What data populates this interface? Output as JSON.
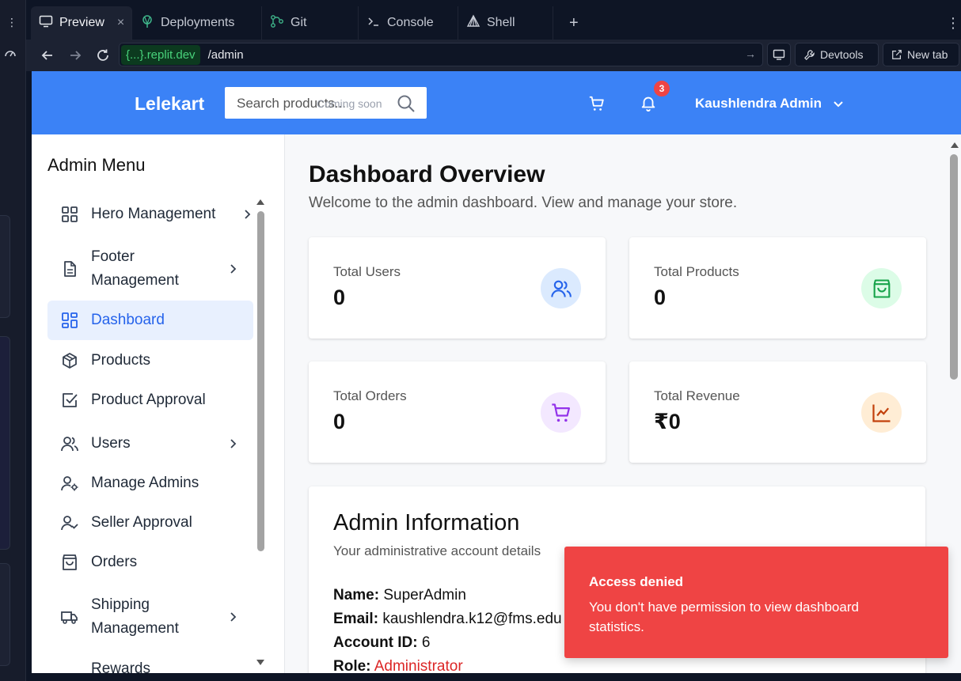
{
  "ide": {
    "tabs": [
      {
        "label": "Preview",
        "icon": "monitor-icon"
      },
      {
        "label": "Deployments",
        "icon": "deploy-icon"
      },
      {
        "label": "Git",
        "icon": "git-icon"
      },
      {
        "label": "Console",
        "icon": "terminal-icon"
      },
      {
        "label": "Shell",
        "icon": "shell-icon"
      }
    ],
    "new_tab_symbol": "+",
    "close_symbol": "×",
    "url_host": "{...}.replit.dev",
    "url_path": "/admin",
    "devtools_label": "Devtools",
    "new_tab_label": "New tab"
  },
  "header": {
    "logo": "Lelekart",
    "search_placeholder": "Search products...",
    "search_badge": "Coming soon",
    "notification_count": "3",
    "user_name": "Kaushlendra Admin"
  },
  "sidebar": {
    "title": "Admin Menu",
    "items": [
      {
        "label": "Hero Management",
        "icon": "grid-icon",
        "has_chevron": true
      },
      {
        "label": "Footer Management",
        "icon": "document-icon",
        "has_chevron": true
      },
      {
        "label": "Dashboard",
        "icon": "dashboard-icon",
        "active": true
      },
      {
        "label": "Products",
        "icon": "box-icon"
      },
      {
        "label": "Product Approval",
        "icon": "check-square-icon"
      },
      {
        "label": "Users",
        "icon": "users-icon",
        "has_chevron": true
      },
      {
        "label": "Manage Admins",
        "icon": "user-cog-icon"
      },
      {
        "label": "Seller Approval",
        "icon": "user-check-icon"
      },
      {
        "label": "Orders",
        "icon": "bag-icon"
      },
      {
        "label": "Shipping Management",
        "icon": "truck-icon",
        "has_chevron": true
      },
      {
        "label": "Rewards",
        "icon": "gift-icon"
      }
    ]
  },
  "main": {
    "title": "Dashboard Overview",
    "subtitle": "Welcome to the admin dashboard. View and manage your store.",
    "stats": [
      {
        "label": "Total Users",
        "value": "0",
        "icon": "users-icon",
        "color": "#2563eb",
        "bg": "#dbeafe"
      },
      {
        "label": "Total Products",
        "value": "0",
        "icon": "shopping-bag-icon",
        "color": "#16a34a",
        "bg": "#dcfce7"
      },
      {
        "label": "Total Orders",
        "value": "0",
        "icon": "cart-icon",
        "color": "#9333ea",
        "bg": "#f3e8ff"
      },
      {
        "label": "Total Revenue",
        "value": "₹0",
        "icon": "chart-line-icon",
        "color": "#c2410c",
        "bg": "#ffedd5"
      }
    ],
    "admin_info": {
      "title": "Admin Information",
      "subtitle": "Your administrative account details",
      "name_label": "Name:",
      "name_value": "SuperAdmin",
      "email_label": "Email:",
      "email_value": "kaushlendra.k12@fms.edu",
      "id_label": "Account ID:",
      "id_value": "6",
      "role_label": "Role:",
      "role_value": "Administrator"
    }
  },
  "toast": {
    "title": "Access denied",
    "message": "You don't have permission to view dashboard statistics.",
    "color": "#ef4444"
  },
  "colors": {
    "brand": "#3b82f6",
    "ide_bg": "#0e1525"
  }
}
